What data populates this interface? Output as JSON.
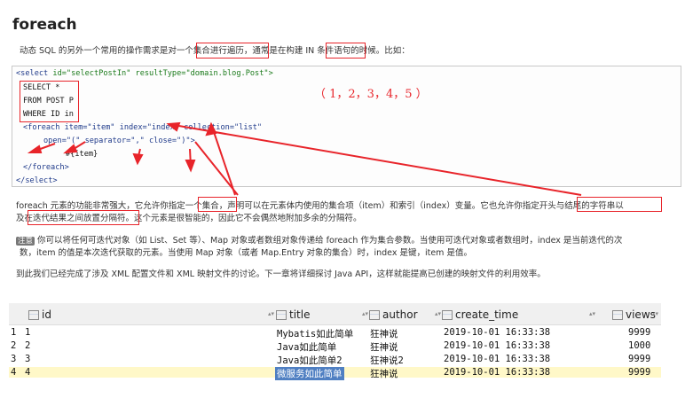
{
  "doc": {
    "title": "foreach",
    "intro": "动态 SQL 的另外一个常用的操作需求是对一个集合进行遍历，通常是在构建 IN 条件语句的时候。比如：",
    "code": {
      "line1_a": "<select ",
      "line1_b": "id=\"selectPostIn\" resultType=\"domain.blog.Post\">",
      "line2": "SELECT *",
      "line3": "FROM POST P",
      "line4": "WHERE ID in",
      "line5": "<foreach item=\"item\" index=\"index\" collection=\"list\"",
      "line6": "open=\"(\" separator=\",\" close=\")\">",
      "line7": "#{item}",
      "line8": "</foreach>",
      "line9": "</select>"
    },
    "annotation": "（ 1，2，3，4，5 ）",
    "para2_line1": "foreach 元素的功能非常强大，它允许你指定一个集合，声明可以在元素体内使用的集合项（item）和索引（index）变量。它也允许你指定开头与结尾的字符串以",
    "para2_line2": "及在迭代结果之间放置分隔符。这个元素是很智能的，因此它不会偶然地附加多余的分隔符。",
    "note_tag": "注意",
    "para3_line1": "你可以将任何可迭代对象（如 List、Set 等）、Map 对象或者数组对象传递给 foreach 作为集合参数。当使用可迭代对象或者数组时，index 是当前迭代的次",
    "para3_line2": "数，item 的值是本次迭代获取的元素。当使用 Map 对象（或者 Map.Entry 对象的集合）时，index 是键，item 是值。",
    "para4": "到此我们已经完成了涉及 XML 配置文件和 XML 映射文件的讨论。下一章将详细探讨 Java API，这样就能提高已创建的映射文件的利用效率。"
  },
  "table": {
    "columns": [
      "id",
      "title",
      "author",
      "create_time",
      "views"
    ],
    "rows": [
      {
        "row": "1",
        "id": "1",
        "title": "Mybatis如此简单",
        "author": "狂神说",
        "create_time": "2019-10-01 16:33:38",
        "views": "9999"
      },
      {
        "row": "2",
        "id": "2",
        "title": "Java如此简单",
        "author": "狂神说",
        "create_time": "2019-10-01 16:33:38",
        "views": "1000"
      },
      {
        "row": "3",
        "id": "3",
        "title": "Java如此简单2",
        "author": "狂神说2",
        "create_time": "2019-10-01 16:33:38",
        "views": "9999"
      },
      {
        "row": "4",
        "id": "4",
        "title": "微服务如此简单",
        "author": "狂神说",
        "create_time": "2019-10-01 16:33:38",
        "views": "9999"
      }
    ],
    "sort_glyph": "▴▾",
    "colors": {
      "highlight_row": "#fff8c8",
      "selected_cell": "#4f7fc2",
      "annotation": "#e8242a"
    }
  }
}
